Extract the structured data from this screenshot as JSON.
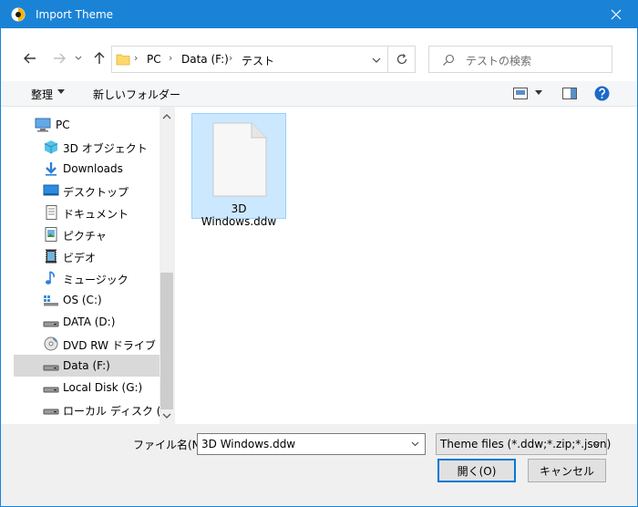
{
  "window": {
    "title": "Import Theme"
  },
  "address": {
    "crumbs": [
      "PC",
      "Data (F:)",
      "テスト"
    ],
    "search_placeholder": "テストの検索"
  },
  "toolbar": {
    "organize": "整理",
    "new_folder": "新しいフォルダー"
  },
  "nav": {
    "items": [
      {
        "label": "PC",
        "icon": "pc-icon"
      },
      {
        "label": "3D オブジェクト",
        "icon": "3d-objects-icon"
      },
      {
        "label": "Downloads",
        "icon": "downloads-icon"
      },
      {
        "label": "デスクトップ",
        "icon": "desktop-icon"
      },
      {
        "label": "ドキュメント",
        "icon": "documents-icon"
      },
      {
        "label": "ピクチャ",
        "icon": "pictures-icon"
      },
      {
        "label": "ビデオ",
        "icon": "videos-icon"
      },
      {
        "label": "ミュージック",
        "icon": "music-icon"
      },
      {
        "label": "OS (C:)",
        "icon": "os-drive-icon"
      },
      {
        "label": "DATA (D:)",
        "icon": "drive-icon"
      },
      {
        "label": "DVD RW ドライブ (E:) A",
        "icon": "dvd-drive-icon"
      },
      {
        "label": "Data (F:)",
        "icon": "drive-icon"
      },
      {
        "label": "Local Disk (G:)",
        "icon": "drive-icon"
      },
      {
        "label": "ローカル ディスク (I:)",
        "icon": "drive-icon"
      }
    ],
    "selected_index": 11
  },
  "files": [
    {
      "name": "3D Windows.ddw",
      "icon": "file-icon",
      "selected": true
    }
  ],
  "bottom": {
    "filename_label": "ファイル名(N):",
    "filename_value": "3D Windows.ddw",
    "filter_value": "Theme files (*.ddw;*.zip;*.json)",
    "open_label": "開く(O)",
    "cancel_label": "キャンセル"
  },
  "colors": {
    "titlebar": "#1b83d6",
    "selection": "#cce8ff",
    "accent": "#0078d7"
  }
}
